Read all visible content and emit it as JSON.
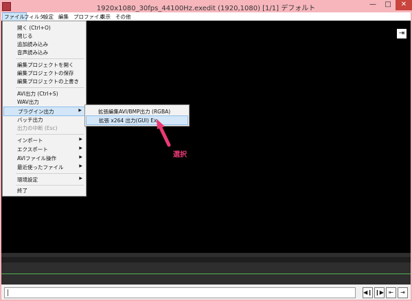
{
  "window": {
    "title": "1920x1080_30fps_44100Hz.exedit (1920,1080)  [1/1]  デフォルト",
    "minimize": "—",
    "maximize": "□",
    "close": "✕"
  },
  "menubar": {
    "items": [
      {
        "label": "ファイル"
      },
      {
        "label": "フィルタ"
      },
      {
        "label": "設定"
      },
      {
        "label": "編集"
      },
      {
        "label": "プロファイル"
      },
      {
        "label": "表示"
      },
      {
        "label": "その他"
      }
    ]
  },
  "file_menu": {
    "items": [
      {
        "label": "開く (Ctrl+O)"
      },
      {
        "label": "閉じる"
      },
      {
        "label": "追加読み込み"
      },
      {
        "label": "音声読み込み"
      },
      {
        "label": "編集プロジェクトを開く"
      },
      {
        "label": "編集プロジェクトの保存"
      },
      {
        "label": "編集プロジェクトの上書き"
      },
      {
        "label": "AVI出力 (Ctrl+S)"
      },
      {
        "label": "WAV出力"
      },
      {
        "label": "プラグイン出力"
      },
      {
        "label": "バッチ出力"
      },
      {
        "label": "出力の中断 (Esc)"
      },
      {
        "label": "インポート"
      },
      {
        "label": "エクスポート"
      },
      {
        "label": "AVIファイル操作"
      },
      {
        "label": "最近使ったファイル"
      },
      {
        "label": "環境設定"
      },
      {
        "label": "終了"
      }
    ],
    "submenu_arrow": "▶"
  },
  "plugin_submenu": {
    "items": [
      {
        "label": "拡張編集AVI/BMP出力 (RGBA)"
      },
      {
        "label": "拡張 x264 出力(GUI) Ex"
      }
    ]
  },
  "annotation": {
    "label": "選択",
    "color": "#ea3a73"
  },
  "canvas": {
    "corner_button": "⇥"
  },
  "playback": {
    "buttons": [
      "◀❙",
      "❙▶",
      "⇤",
      "⇥"
    ]
  }
}
